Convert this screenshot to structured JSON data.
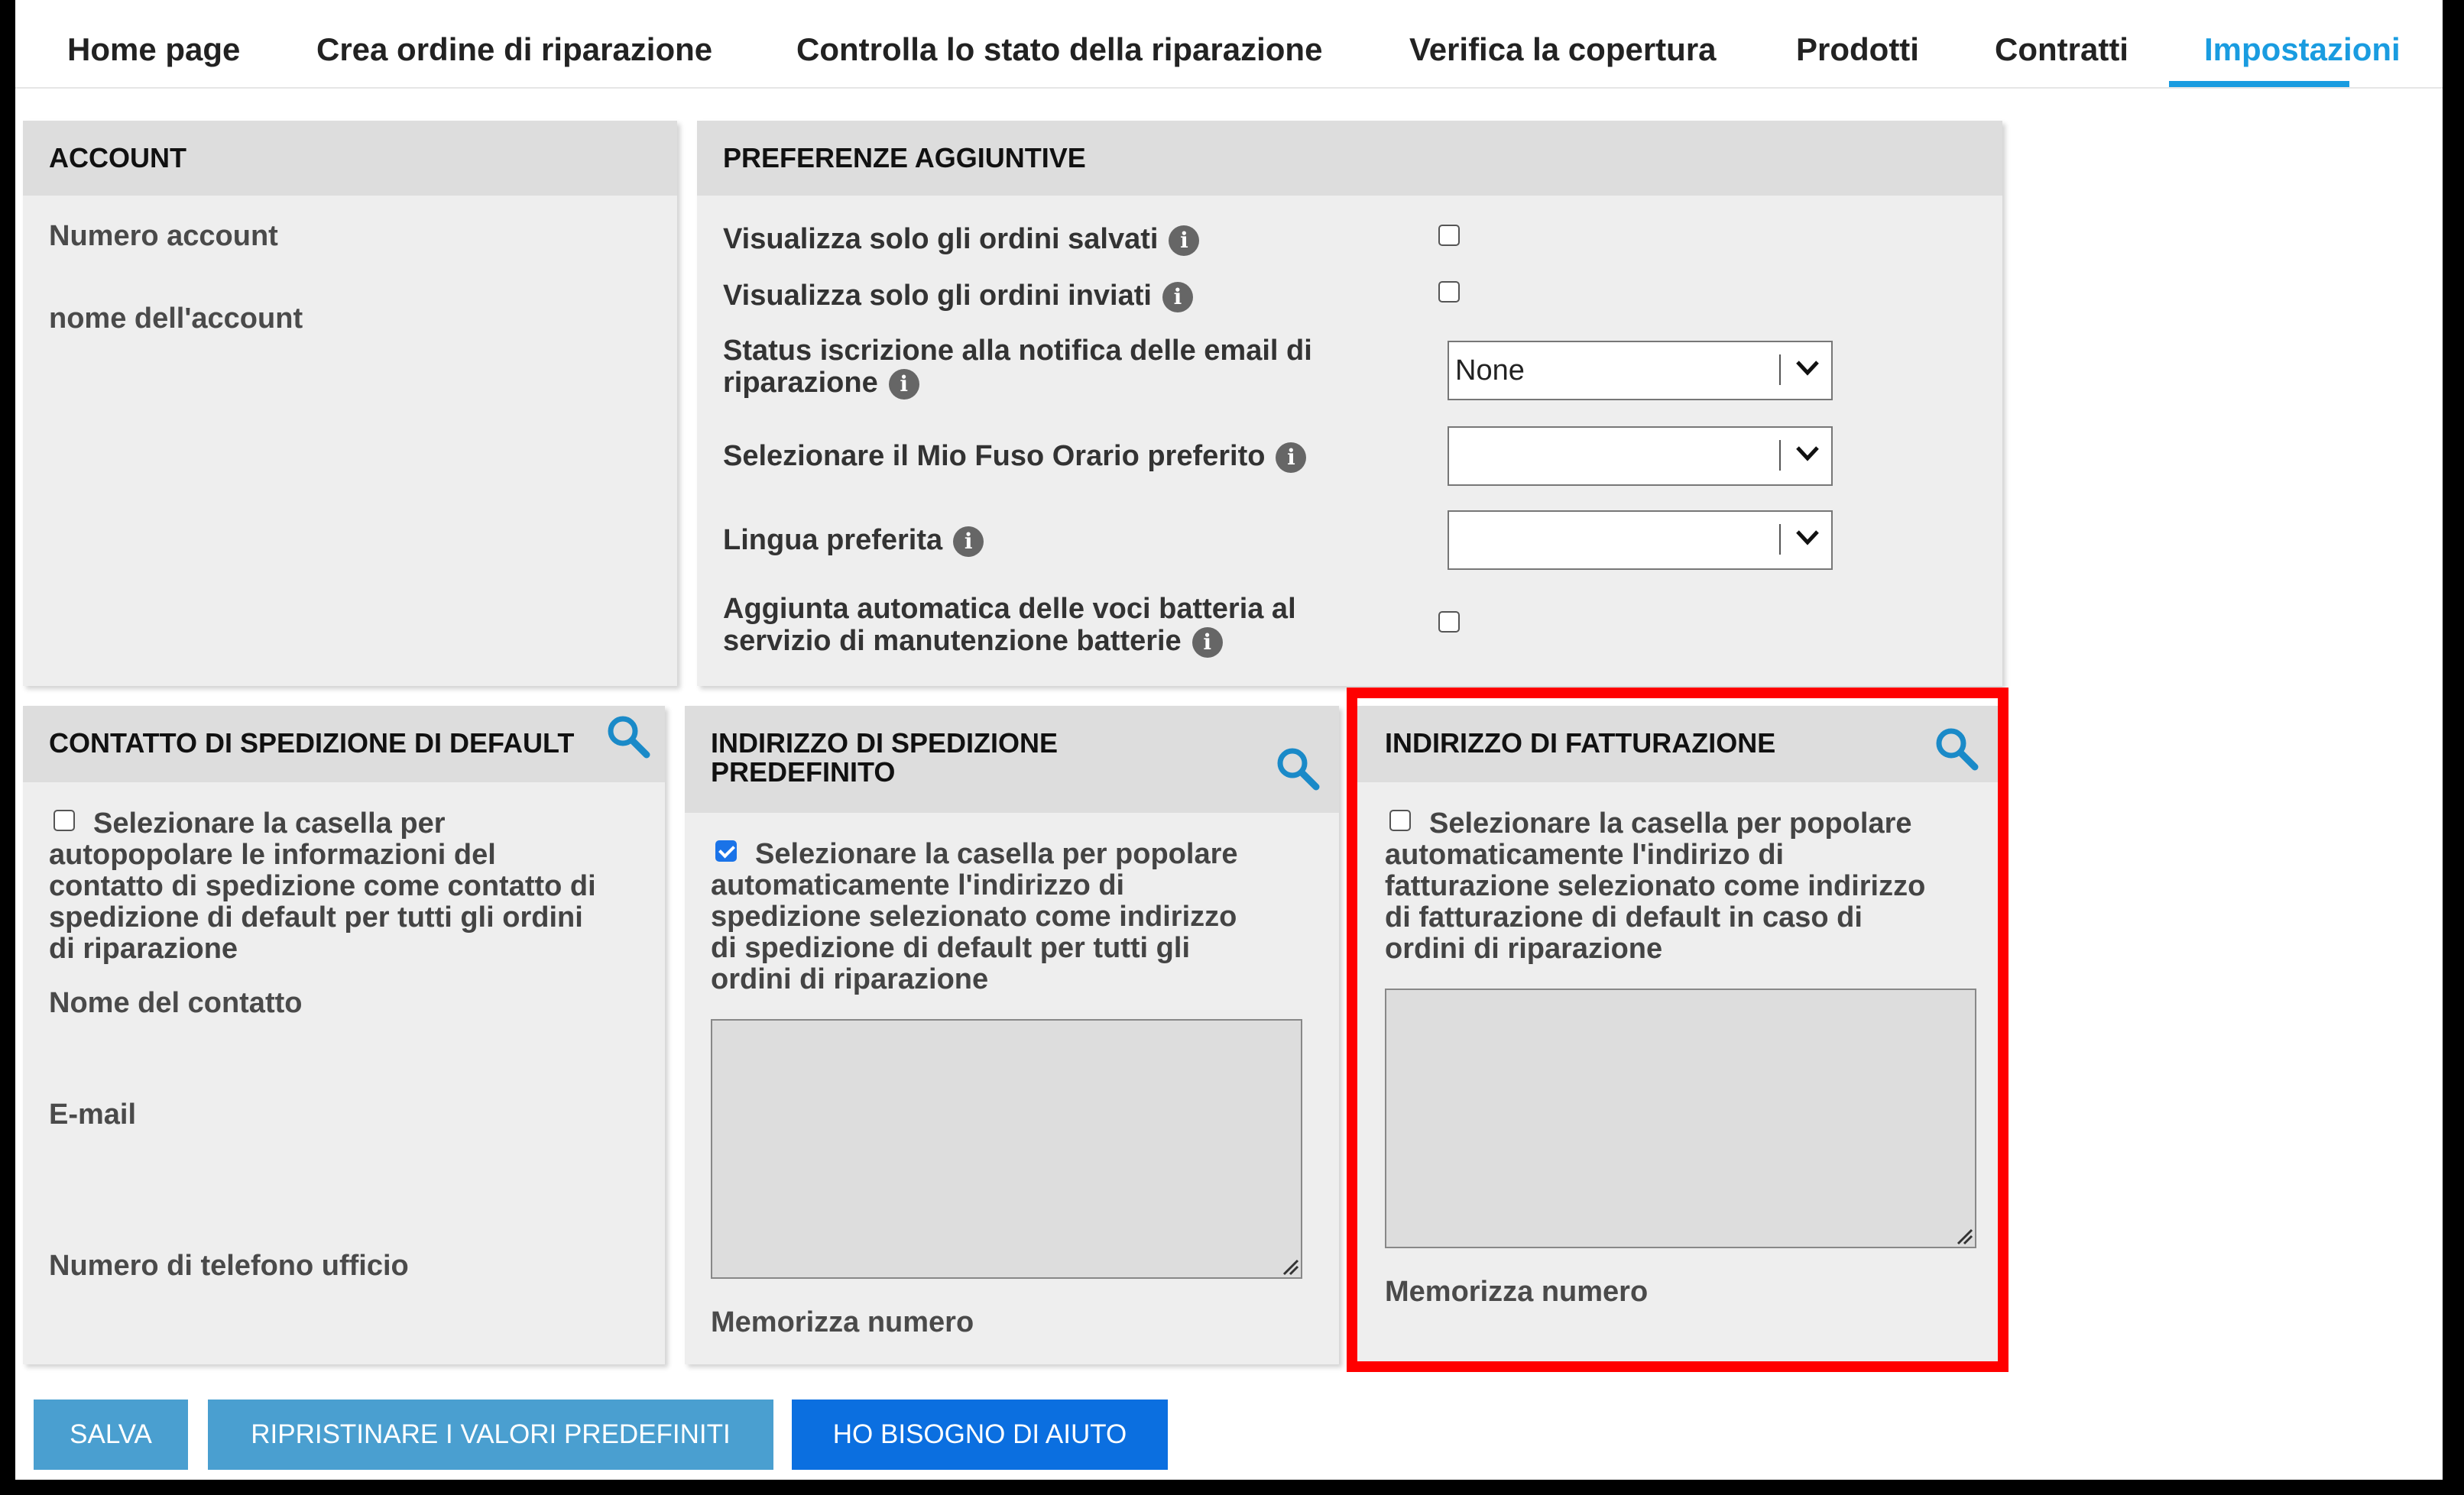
{
  "nav": {
    "tabs": [
      {
        "label": "Home page"
      },
      {
        "label": "Crea ordine di riparazione"
      },
      {
        "label": "Controlla lo stato della riparazione"
      },
      {
        "label": "Verifica la copertura"
      },
      {
        "label": "Prodotti"
      },
      {
        "label": "Contratti"
      },
      {
        "label": "Impostazioni"
      }
    ],
    "active_tab": "Impostazioni"
  },
  "account": {
    "title": "ACCOUNT",
    "number_label": "Numero account",
    "name_label": "nome dell'account"
  },
  "preferences": {
    "title": "PREFERENZE AGGIUNTIVE",
    "info_glyph": "i",
    "saved_orders": {
      "label": "Visualizza solo gli ordini salvati",
      "checked": false
    },
    "sent_orders": {
      "label": "Visualizza solo gli ordini inviati",
      "checked": false
    },
    "email_status": {
      "label_line1": "Status iscrizione alla notifica delle email di",
      "label_line2": "riparazione",
      "value": "None"
    },
    "timezone": {
      "label": "Selezionare il Mio Fuso Orario preferito",
      "value": ""
    },
    "language": {
      "label": "Lingua preferita",
      "value": ""
    },
    "battery": {
      "label_line1": "Aggiunta automatica delle voci batteria al",
      "label_line2": "servizio di manutenzione batterie",
      "checked": false
    }
  },
  "shipping_contact": {
    "title": "CONTATTO DI SPEDIZIONE DI DEFAULT",
    "checked": false,
    "checkbox_text": [
      "Selezionare la casella per",
      "autopopolare le informazioni del",
      "contatto di spedizione come contatto di",
      "spedizione di default per tutti gli ordini",
      "di riparazione"
    ],
    "contact_name_label": "Nome del contatto",
    "email_label": "E-mail",
    "phone_label": "Numero di telefono ufficio"
  },
  "shipping_address": {
    "title_line1": "INDIRIZZO DI SPEDIZIONE",
    "title_line2": "PREDEFINITO",
    "checked": true,
    "checkbox_text": [
      "Selezionare la casella per popolare",
      "automaticamente l'indirizzo di",
      "spedizione selezionato come indirizzo",
      "di spedizione di default per tutti gli",
      "ordini di riparazione"
    ],
    "store_number_label": "Memorizza numero"
  },
  "billing_address": {
    "title": "INDIRIZZO DI FATTURAZIONE",
    "checked": false,
    "checkbox_text": [
      "Selezionare la casella per popolare",
      "automaticamente l'indirizo di",
      "fatturazione selezionato come indirizzo",
      "di fatturazione di default in caso di",
      "ordini di riparazione"
    ],
    "store_number_label": "Memorizza numero",
    "highlight_color": "#ff0000"
  },
  "buttons": {
    "save": "SALVA",
    "restore": "RIPRISTINARE I VALORI PREDEFINITI",
    "help": "HO BISOGNO DI AIUTO"
  },
  "colors": {
    "accent": "#1a9ce0",
    "button_light": "#4a9fd0",
    "button_primary": "#0b6fe0"
  }
}
